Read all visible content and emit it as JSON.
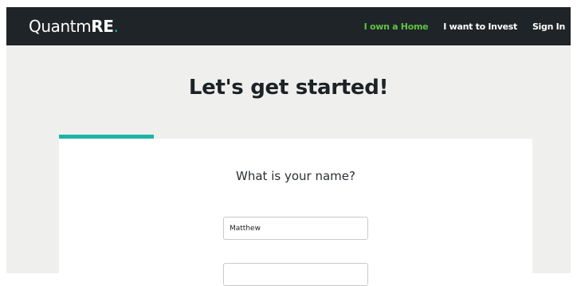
{
  "brand": {
    "name_prefix": "Quantm",
    "name_suffix": "RE",
    "dot": "."
  },
  "nav": {
    "items": [
      {
        "label": "I own a Home",
        "active": true
      },
      {
        "label": "I want to Invest",
        "active": false
      },
      {
        "label": "Sign In",
        "active": false
      }
    ]
  },
  "main": {
    "title": "Let's get started!",
    "question": "What is your name?",
    "first_name": {
      "value": "Matthew"
    },
    "last_name": {
      "value": ""
    }
  },
  "progress": {
    "fraction": 0.2
  },
  "colors": {
    "nav_background": "#1f2428",
    "accent_teal": "#1db4a6",
    "active_link_green": "#5ec441",
    "page_background": "#efefed"
  }
}
